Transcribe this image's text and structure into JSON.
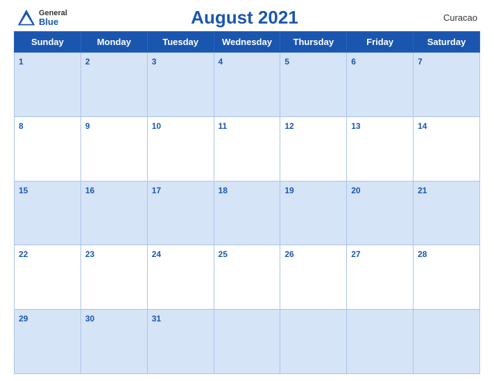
{
  "header": {
    "logo_general": "General",
    "logo_blue": "Blue",
    "title": "August 2021",
    "region": "Curacao"
  },
  "weekdays": [
    "Sunday",
    "Monday",
    "Tuesday",
    "Wednesday",
    "Thursday",
    "Friday",
    "Saturday"
  ],
  "weeks": [
    [
      {
        "day": 1,
        "empty": false
      },
      {
        "day": 2,
        "empty": false
      },
      {
        "day": 3,
        "empty": false
      },
      {
        "day": 4,
        "empty": false
      },
      {
        "day": 5,
        "empty": false
      },
      {
        "day": 6,
        "empty": false
      },
      {
        "day": 7,
        "empty": false
      }
    ],
    [
      {
        "day": 8,
        "empty": false
      },
      {
        "day": 9,
        "empty": false
      },
      {
        "day": 10,
        "empty": false
      },
      {
        "day": 11,
        "empty": false
      },
      {
        "day": 12,
        "empty": false
      },
      {
        "day": 13,
        "empty": false
      },
      {
        "day": 14,
        "empty": false
      }
    ],
    [
      {
        "day": 15,
        "empty": false
      },
      {
        "day": 16,
        "empty": false
      },
      {
        "day": 17,
        "empty": false
      },
      {
        "day": 18,
        "empty": false
      },
      {
        "day": 19,
        "empty": false
      },
      {
        "day": 20,
        "empty": false
      },
      {
        "day": 21,
        "empty": false
      }
    ],
    [
      {
        "day": 22,
        "empty": false
      },
      {
        "day": 23,
        "empty": false
      },
      {
        "day": 24,
        "empty": false
      },
      {
        "day": 25,
        "empty": false
      },
      {
        "day": 26,
        "empty": false
      },
      {
        "day": 27,
        "empty": false
      },
      {
        "day": 28,
        "empty": false
      }
    ],
    [
      {
        "day": 29,
        "empty": false
      },
      {
        "day": 30,
        "empty": false
      },
      {
        "day": 31,
        "empty": false
      },
      {
        "day": null,
        "empty": true
      },
      {
        "day": null,
        "empty": true
      },
      {
        "day": null,
        "empty": true
      },
      {
        "day": null,
        "empty": true
      }
    ]
  ]
}
